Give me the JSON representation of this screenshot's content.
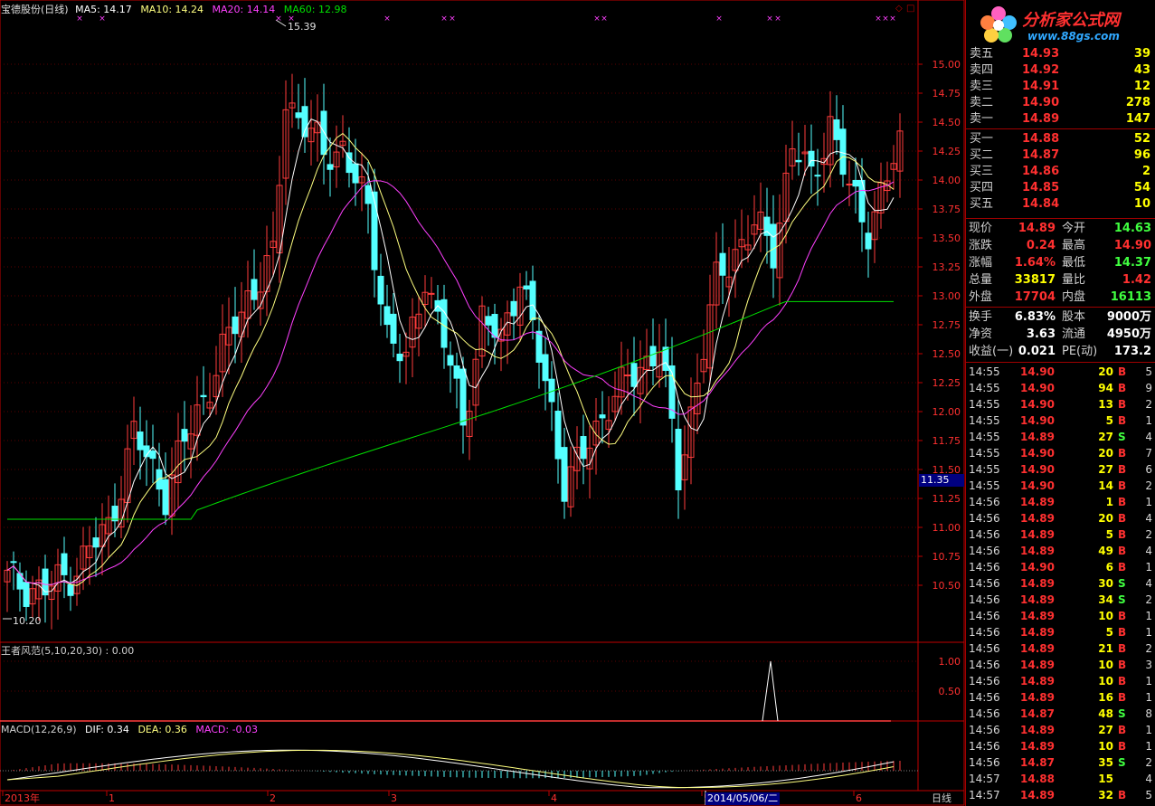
{
  "header": {
    "stock": "宝德股份(日线)",
    "ma5": "MA5: 14.17",
    "ma10": "MA10: 14.24",
    "ma20": "MA20: 14.14",
    "ma60": "MA60: 12.98"
  },
  "colors": {
    "up": "#ff3c3c",
    "down": "#54ffff",
    "ma5": "#ffffff",
    "ma10": "#ffff80",
    "ma20": "#ff40ff",
    "ma60": "#00e000",
    "axis": "#c00000",
    "label": "#ff3030"
  },
  "main": {
    "price_labels": [
      "15.00",
      "14.75",
      "14.50",
      "14.25",
      "14.00",
      "13.75",
      "13.50",
      "13.25",
      "13.00",
      "12.75",
      "12.50",
      "12.25",
      "12.00",
      "11.75",
      "11.50",
      "11.25",
      "11.00",
      "10.75",
      "10.50"
    ],
    "high_label": "15.39",
    "low_label": "10.20",
    "cursor_price": "11.35"
  },
  "indicator1": {
    "title": "王者风范(5,10,20,30) : 0.00",
    "labels": [
      "1.00",
      "0.50"
    ]
  },
  "macd": {
    "title": "MACD(12,26,9)",
    "dif": "DIF: 0.34",
    "dea": "DEA: 0.36",
    "macd": "MACD: -0.03"
  },
  "xaxis": {
    "labels": [
      "2013年",
      "1",
      "2",
      "3",
      "4",
      "5",
      "6"
    ],
    "cursor_date": "2014/05/06/二",
    "period": "日线"
  },
  "logo": {
    "name": "分析家公式网",
    "url": "www.88gs.com"
  },
  "orderbook": {
    "asks": [
      {
        "label": "卖五",
        "price": "14.93",
        "vol": "39"
      },
      {
        "label": "卖四",
        "price": "14.92",
        "vol": "43"
      },
      {
        "label": "卖三",
        "price": "14.91",
        "vol": "12"
      },
      {
        "label": "卖二",
        "price": "14.90",
        "vol": "278"
      },
      {
        "label": "卖一",
        "price": "14.89",
        "vol": "147"
      }
    ],
    "bids": [
      {
        "label": "买一",
        "price": "14.88",
        "vol": "52"
      },
      {
        "label": "买二",
        "price": "14.87",
        "vol": "96"
      },
      {
        "label": "买三",
        "price": "14.86",
        "vol": "2"
      },
      {
        "label": "买四",
        "price": "14.85",
        "vol": "54"
      },
      {
        "label": "买五",
        "price": "14.84",
        "vol": "10"
      }
    ]
  },
  "stats1": [
    {
      "l1": "现价",
      "v1": "14.89",
      "c1": "#ff3030",
      "l2": "今开",
      "v2": "14.63",
      "c2": "#40ff40"
    },
    {
      "l1": "涨跌",
      "v1": "0.24",
      "c1": "#ff3030",
      "l2": "最高",
      "v2": "14.90",
      "c2": "#ff3030"
    },
    {
      "l1": "涨幅",
      "v1": "1.64%",
      "c1": "#ff3030",
      "l2": "最低",
      "v2": "14.37",
      "c2": "#40ff40"
    },
    {
      "l1": "总量",
      "v1": "33817",
      "c1": "#ffff00",
      "l2": "量比",
      "v2": "1.42",
      "c2": "#ff3030"
    },
    {
      "l1": "外盘",
      "v1": "17704",
      "c1": "#ff3030",
      "l2": "内盘",
      "v2": "16113",
      "c2": "#40ff40"
    }
  ],
  "stats2": [
    {
      "l1": "换手",
      "v1": "6.83%",
      "c1": "#ffffff",
      "l2": "股本",
      "v2": "9000万",
      "c2": "#ffffff"
    },
    {
      "l1": "净资",
      "v1": "3.63",
      "c1": "#ffffff",
      "l2": "流通",
      "v2": "4950万",
      "c2": "#ffffff"
    },
    {
      "l1": "收益(一)",
      "v1": "0.021",
      "c1": "#ffffff",
      "l2": "PE(动)",
      "v2": "173.2",
      "c2": "#ffffff"
    }
  ],
  "trades": [
    {
      "t": "14:55",
      "p": "14.90",
      "v": "20",
      "f": "B",
      "n": "5"
    },
    {
      "t": "14:55",
      "p": "14.90",
      "v": "94",
      "f": "B",
      "n": "9"
    },
    {
      "t": "14:55",
      "p": "14.90",
      "v": "13",
      "f": "B",
      "n": "2"
    },
    {
      "t": "14:55",
      "p": "14.90",
      "v": "5",
      "f": "B",
      "n": "1"
    },
    {
      "t": "14:55",
      "p": "14.89",
      "v": "27",
      "f": "S",
      "n": "4"
    },
    {
      "t": "14:55",
      "p": "14.90",
      "v": "20",
      "f": "B",
      "n": "7"
    },
    {
      "t": "14:55",
      "p": "14.90",
      "v": "27",
      "f": "B",
      "n": "6"
    },
    {
      "t": "14:55",
      "p": "14.90",
      "v": "14",
      "f": "B",
      "n": "2"
    },
    {
      "t": "14:56",
      "p": "14.89",
      "v": "1",
      "f": "B",
      "n": "1"
    },
    {
      "t": "14:56",
      "p": "14.89",
      "v": "20",
      "f": "B",
      "n": "4"
    },
    {
      "t": "14:56",
      "p": "14.89",
      "v": "5",
      "f": "B",
      "n": "2"
    },
    {
      "t": "14:56",
      "p": "14.89",
      "v": "49",
      "f": "B",
      "n": "4"
    },
    {
      "t": "14:56",
      "p": "14.90",
      "v": "6",
      "f": "B",
      "n": "1"
    },
    {
      "t": "14:56",
      "p": "14.89",
      "v": "30",
      "f": "S",
      "n": "4"
    },
    {
      "t": "14:56",
      "p": "14.89",
      "v": "34",
      "f": "S",
      "n": "2"
    },
    {
      "t": "14:56",
      "p": "14.89",
      "v": "10",
      "f": "B",
      "n": "1"
    },
    {
      "t": "14:56",
      "p": "14.89",
      "v": "5",
      "f": "B",
      "n": "1"
    },
    {
      "t": "14:56",
      "p": "14.89",
      "v": "21",
      "f": "B",
      "n": "2"
    },
    {
      "t": "14:56",
      "p": "14.89",
      "v": "10",
      "f": "B",
      "n": "3"
    },
    {
      "t": "14:56",
      "p": "14.89",
      "v": "10",
      "f": "B",
      "n": "1"
    },
    {
      "t": "14:56",
      "p": "14.89",
      "v": "16",
      "f": "B",
      "n": "1"
    },
    {
      "t": "14:56",
      "p": "14.87",
      "v": "48",
      "f": "S",
      "n": "8"
    },
    {
      "t": "14:56",
      "p": "14.89",
      "v": "27",
      "f": "B",
      "n": "1"
    },
    {
      "t": "14:56",
      "p": "14.89",
      "v": "10",
      "f": "B",
      "n": "1"
    },
    {
      "t": "14:56",
      "p": "14.87",
      "v": "35",
      "f": "S",
      "n": "2"
    },
    {
      "t": "14:57",
      "p": "14.88",
      "v": "15",
      "f": "",
      "n": "4"
    },
    {
      "t": "14:57",
      "p": "14.89",
      "v": "32",
      "f": "B",
      "n": "5"
    }
  ]
}
